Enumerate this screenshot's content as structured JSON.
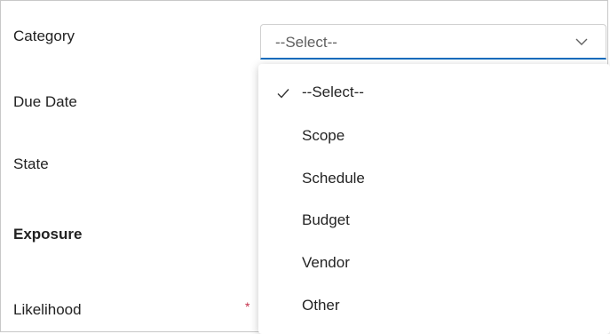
{
  "form": {
    "labels": {
      "category": "Category",
      "due_date": "Due Date",
      "state": "State",
      "exposure": "Exposure",
      "likelihood": "Likelihood"
    },
    "required_marker": "*"
  },
  "category_select": {
    "value": "--Select--",
    "icon": "chevron-down-icon",
    "accent_color": "#0f6cbd"
  },
  "dropdown": {
    "selected_icon": "checkmark-icon",
    "options": [
      {
        "label": "--Select--",
        "selected": true
      },
      {
        "label": "Scope",
        "selected": false
      },
      {
        "label": "Schedule",
        "selected": false
      },
      {
        "label": "Budget",
        "selected": false
      },
      {
        "label": "Vendor",
        "selected": false
      },
      {
        "label": "Other",
        "selected": false
      }
    ]
  }
}
